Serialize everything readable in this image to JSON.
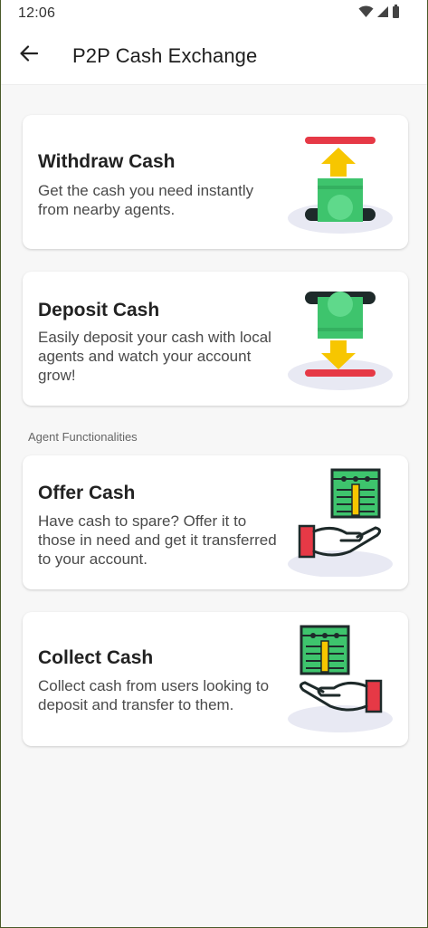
{
  "status_bar": {
    "time": "12:06",
    "icons": [
      "wifi-icon",
      "signal-icon",
      "battery-icon"
    ]
  },
  "app_bar": {
    "back_icon": "arrow-left-icon",
    "title": "P2P Cash Exchange"
  },
  "cards": {
    "withdraw": {
      "title": "Withdraw Cash",
      "description": "Get the cash you need instantly from nearby agents.",
      "icon": "withdraw-cash-icon"
    },
    "deposit": {
      "title": "Deposit Cash",
      "description": "Easily deposit your cash with local agents and watch your account grow!",
      "icon": "deposit-cash-icon"
    },
    "offer": {
      "title": "Offer Cash",
      "description": "Have cash to spare? Offer it to those in need and get it transferred to your account.",
      "icon": "offer-cash-icon"
    },
    "collect": {
      "title": "Collect Cash",
      "description": "Collect cash from users looking to deposit and transfer to them.",
      "icon": "collect-cash-icon"
    }
  },
  "section": {
    "agent_label": "Agent Functionalities"
  },
  "colors": {
    "accent_red": "#e63946",
    "accent_yellow": "#f7c600",
    "cash_green": "#3ec46d",
    "dark": "#1e2a2a",
    "platform": "#e8e9f3"
  }
}
